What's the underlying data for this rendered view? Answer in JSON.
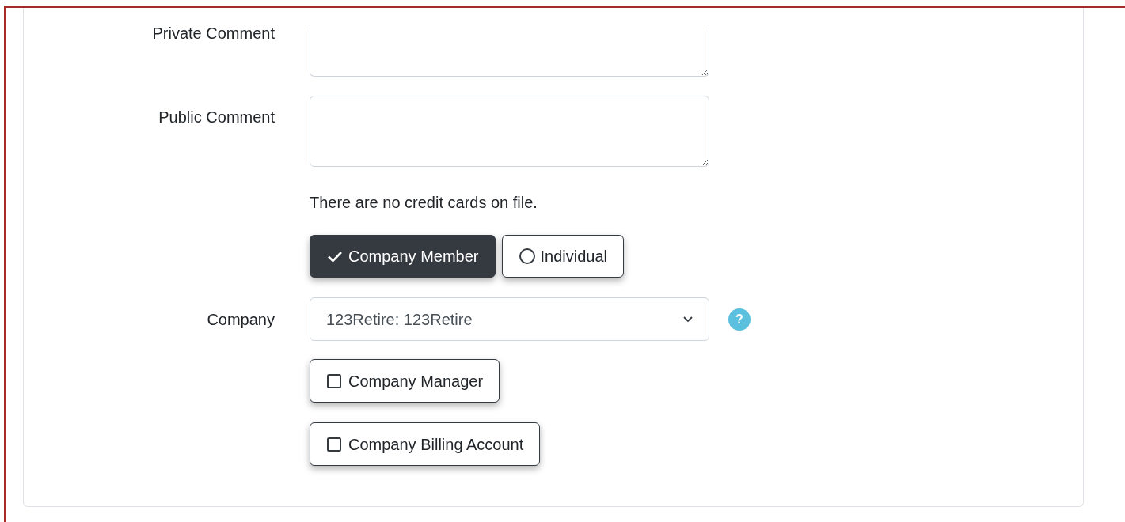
{
  "comments": [
    {
      "label": "Private Comment"
    },
    {
      "label": "Public Comment"
    }
  ],
  "credit_card_note": "There are no credit cards on file.",
  "membership_toggle": [
    {
      "label": "Company Member",
      "selected": true
    },
    {
      "label": "Individual",
      "selected": false
    }
  ],
  "company": {
    "label": "Company",
    "value": "123Retire: 123Retire",
    "help": "?"
  },
  "options": [
    {
      "label": "Company Manager",
      "checked": false
    },
    {
      "label": "Company Billing Account",
      "checked": false
    }
  ]
}
